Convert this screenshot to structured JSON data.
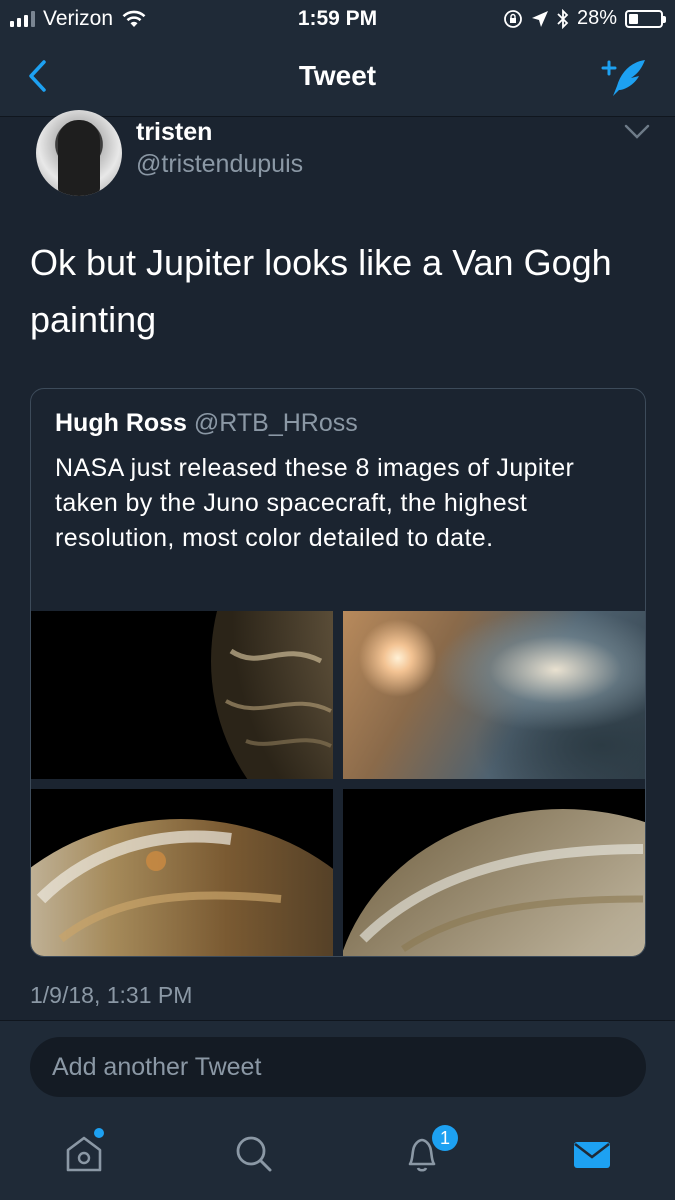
{
  "status_bar": {
    "carrier": "Verizon",
    "time": "1:59 PM",
    "battery": "28%",
    "battery_level": 0.28,
    "icons": [
      "wifi-icon",
      "lock-rotation-icon",
      "location-arrow-icon",
      "bluetooth-icon",
      "battery-icon"
    ]
  },
  "nav": {
    "title": "Tweet",
    "back_icon": "chevron-left-icon",
    "compose_icon": "compose-tweet-icon"
  },
  "tweet": {
    "author_name": "tristen",
    "author_handle": "@tristendupuis",
    "text": "Ok but Jupiter looks like a Van Gogh painting",
    "timestamp": "1/9/18, 1:31 PM"
  },
  "quoted_tweet": {
    "author_name": "Hugh Ross",
    "author_handle": "@RTB_HRoss",
    "text": "NASA just released these 8 images of Jupiter taken by the Juno spacecraft, the highest resolution, most color detailed to date."
  },
  "reply": {
    "placeholder": "Add another Tweet"
  },
  "tabbar": {
    "notifications_badge": "1",
    "accent": "#1da1f2",
    "icons": [
      "home-icon",
      "search-icon",
      "notifications-icon",
      "messages-icon"
    ]
  }
}
